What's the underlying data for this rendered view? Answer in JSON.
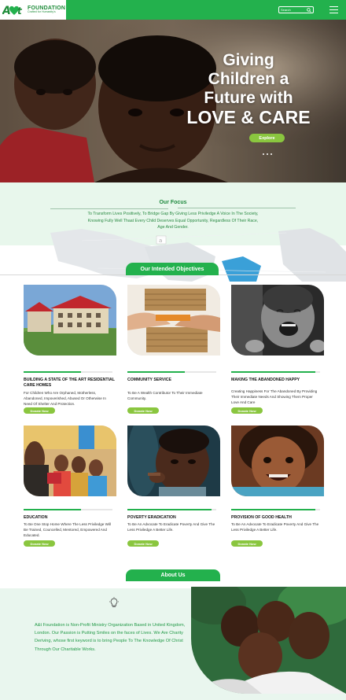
{
  "header": {
    "logo_name": "FOUNDATION",
    "logo_tagline": "Crafted for Humanity's",
    "search_placeholder": "Search",
    "brand_color": "#23b14d"
  },
  "hero": {
    "title_line1": "Giving",
    "title_line2": "Children a",
    "title_line3": "Future with",
    "title_line4": "LOVE & CARE",
    "cta_label": "Explore"
  },
  "focus": {
    "title": "Our Focus",
    "text": "To Transform Lives Positively, To Bridge Gap By Giving Less Priviledge  A Voice In The Society, Knowing Fully Well Thaat Every Child Deserves Equal Opportunity, Regardless Of Their Race, Age And Gender."
  },
  "objectives": {
    "title": "Our Intended Objectives",
    "donate_label": "Donate Now",
    "items": [
      {
        "title": "BUILDING  A  STATE OF THE ART  RESIDENTIAL CARE HOMES",
        "text": "For Children Who Are Orphaned, Motherless, Abandoned, Impoverished, Abused Or Otherwise In Need Of Shelter And Protection."
      },
      {
        "title": "COMMUNITY SERVICE",
        "text": "To Be A Wealth Contributor To Their Immediate Community."
      },
      {
        "title": "MAKING THE ABANDONED HAPPY",
        "text": "Creating Happiness For The Abandoned By Providing Their Immediate Needs And Showing Them Proper Love And Care"
      },
      {
        "title": "EDUCATION",
        "text": "To Be One Stop Home Where The Less Priviledge Will Be Trained, Councelled, Mentored, Empowered And Educated."
      },
      {
        "title": "POVERTY ERADICATION",
        "text": "To Be An Advocate To Eradicate Poverty And Give The Less Priviledge A Better Life."
      },
      {
        "title": "PROVISION OF GOOD HEALTH",
        "text": "To Be An Advocate To Eradicate Poverty And Give The Less Priviledge A Better Life."
      }
    ]
  },
  "about": {
    "title": "About Us",
    "text": "A&t Foundation is  Non-Profit Ministry Organization Based in United Kingdom, London. Our Passion is Putting Smiles on the faces of Lives. We Are Charity Deriving, whose first keyword is to bring People To The Knowledge Of Christ Through Our Charitable Works."
  }
}
